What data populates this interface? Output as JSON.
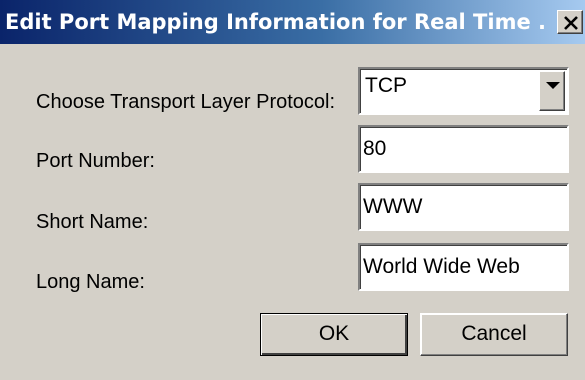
{
  "dialog": {
    "title": "Edit Port Mapping Information for Real Time ...",
    "close_icon": "close-icon"
  },
  "form": {
    "protocol_label": "Choose Transport Layer Protocol:",
    "protocol_selected": "TCP",
    "dropdown_icon": "chevron-down-icon",
    "port_label": "Port Number:",
    "port_value": "80",
    "short_name_label": "Short Name:",
    "short_name_value": "WWW",
    "long_name_label": "Long Name:",
    "long_name_value": "World Wide Web"
  },
  "buttons": {
    "ok_label": "OK",
    "cancel_label": "Cancel"
  }
}
